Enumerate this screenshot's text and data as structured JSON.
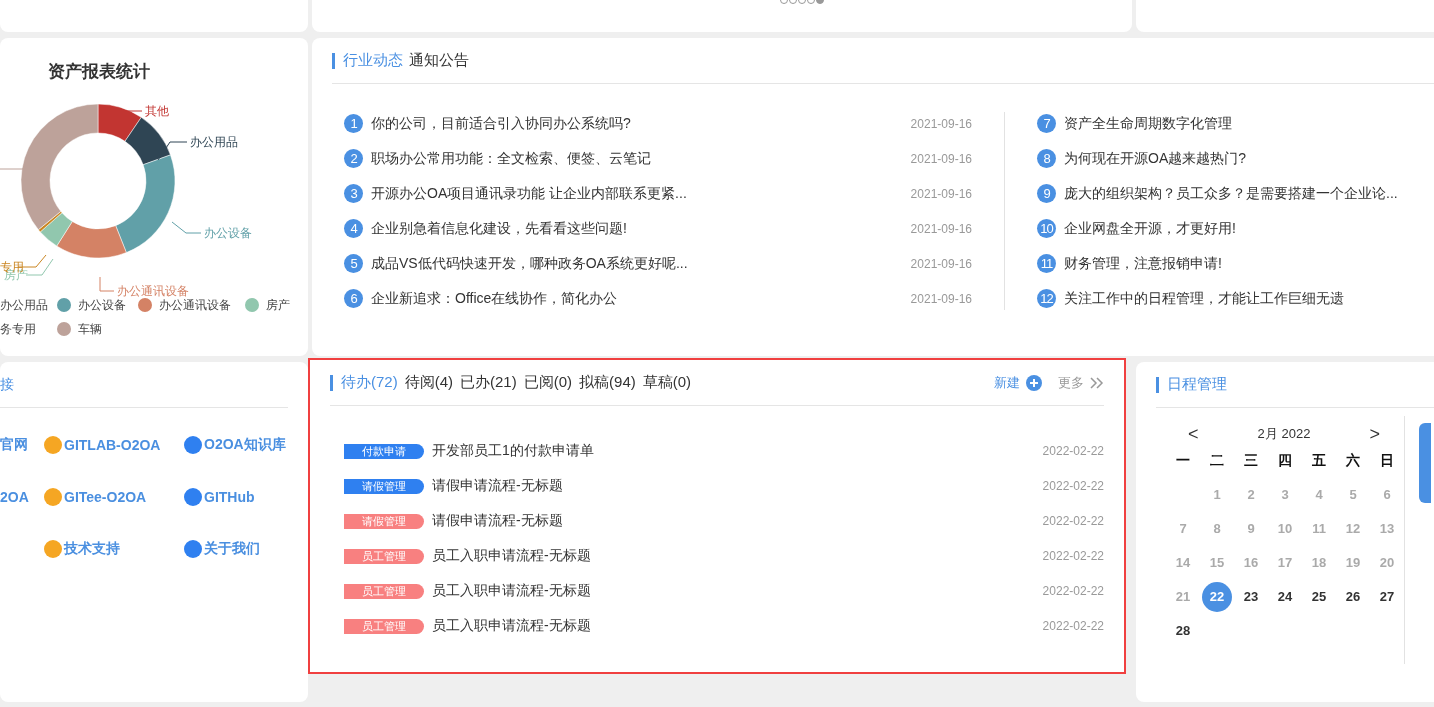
{
  "carousel_dots": [
    {
      "selected": false
    },
    {
      "selected": false
    },
    {
      "selected": false
    },
    {
      "selected": false
    },
    {
      "selected": true
    }
  ],
  "asset_chart": {
    "title": "资产报表统计",
    "slices": [
      {
        "label": "其他",
        "color": "#c23531"
      },
      {
        "label": "办公用品",
        "color": "#2f4554"
      },
      {
        "label": "办公设备",
        "color": "#61a0a8"
      },
      {
        "label": "办公通讯设备",
        "color": "#d48265"
      },
      {
        "label": "房产",
        "color": "#91c7ae"
      },
      {
        "label": "专用",
        "color": "#ca8622"
      },
      {
        "color": "#bda29a"
      }
    ],
    "legend": [
      {
        "label": "办公用品"
      },
      {
        "label": "办公设备",
        "color": "#61a0a8"
      },
      {
        "label": "办公通讯设备",
        "color": "#d48265"
      },
      {
        "label": "房产",
        "color": "#91c7ae"
      },
      {
        "label": "务专用"
      },
      {
        "label": "车辆",
        "color": "#bda29a"
      }
    ]
  },
  "news": {
    "tabs": [
      {
        "label": "行业动态",
        "selected": true
      },
      {
        "label": "通知公告",
        "selected": false
      }
    ],
    "columns": [
      [
        {
          "num": "1",
          "title": "你的公司，目前适合引入协同办公系统吗?",
          "date": "2021-09-16"
        },
        {
          "num": "2",
          "title": "职场办公常用功能：全文检索、便签、云笔记",
          "date": "2021-09-16"
        },
        {
          "num": "3",
          "title": "开源办公OA项目通讯录功能 让企业内部联系更紧...",
          "date": "2021-09-16"
        },
        {
          "num": "4",
          "title": "企业别急着信息化建设，先看看这些问题!",
          "date": "2021-09-16"
        },
        {
          "num": "5",
          "title": "成品VS低代码快速开发，哪种政务OA系统更好呢...",
          "date": "2021-09-16"
        },
        {
          "num": "6",
          "title": "企业新追求：Office在线协作，简化办公",
          "date": "2021-09-16"
        }
      ],
      [
        {
          "num": "7",
          "title": "资产全生命周期数字化管理"
        },
        {
          "num": "8",
          "title": "为何现在开源OA越来越热门?"
        },
        {
          "num": "9",
          "title": "庞大的组织架构？员工众多？是需要搭建一个企业论..."
        },
        {
          "num": "10",
          "title": "企业网盘全开源，才更好用!"
        },
        {
          "num": "11",
          "title": "财务管理，注意报销申请!"
        },
        {
          "num": "12",
          "title": "关注工作中的日程管理，才能让工作巨细无遗"
        }
      ]
    ]
  },
  "links": {
    "title": "接",
    "columns": [
      [
        {
          "label": "官网"
        },
        {
          "label": "2OA"
        }
      ],
      [
        {
          "label": "GITLAB-O2OA",
          "color": "#f5a623"
        },
        {
          "label": "GITee-O2OA",
          "color": "#f5a623"
        },
        {
          "label": "技术支持",
          "color": "#f5a623"
        }
      ],
      [
        {
          "label": "O2OA知识库",
          "color": "#2f80f0"
        },
        {
          "label": "GITHub",
          "color": "#2f80f0"
        },
        {
          "label": "关于我们",
          "color": "#2f80f0"
        }
      ]
    ]
  },
  "tasks": {
    "tabs": [
      {
        "label": "待办(72)",
        "selected": true
      },
      {
        "label": "待阅(4)",
        "selected": false
      },
      {
        "label": "已办(21)",
        "selected": false
      },
      {
        "label": "已阅(0)",
        "selected": false
      },
      {
        "label": "拟稿(94)",
        "selected": false
      },
      {
        "label": "草稿(0)",
        "selected": false
      }
    ],
    "new_label": "新建",
    "more_label": "更多",
    "items": [
      {
        "tag": "付款申请",
        "color": "#2f80f0",
        "title": "开发部员工1的付款申请单",
        "date": "2022-02-22"
      },
      {
        "tag": "请假管理",
        "color": "#2f80f0",
        "title": "请假申请流程-无标题",
        "date": "2022-02-22"
      },
      {
        "tag": "请假管理",
        "color": "#f88080",
        "title": "请假申请流程-无标题",
        "date": "2022-02-22"
      },
      {
        "tag": "员工管理",
        "color": "#f88080",
        "title": "员工入职申请流程-无标题",
        "date": "2022-02-22"
      },
      {
        "tag": "员工管理",
        "color": "#f88080",
        "title": "员工入职申请流程-无标题",
        "date": "2022-02-22"
      },
      {
        "tag": "员工管理",
        "color": "#f88080",
        "title": "员工入职申请流程-无标题",
        "date": "2022-02-22"
      }
    ]
  },
  "schedule": {
    "title": "日程管理",
    "prev": "<",
    "month": "2月 2022",
    "next": ">",
    "weekdays": [
      "一",
      "二",
      "三",
      "四",
      "五",
      "六",
      "日"
    ],
    "weeks": [
      [
        {
          "day": "1",
          "past": true,
          "selected": false
        },
        {
          "day": "2",
          "past": true,
          "selected": false
        },
        {
          "day": "3",
          "past": true,
          "selected": false
        },
        {
          "day": "4",
          "past": true,
          "selected": false
        },
        {
          "day": "5",
          "past": true,
          "selected": false
        },
        {
          "day": "6",
          "past": true,
          "selected": false
        }
      ],
      [
        {
          "day": "7",
          "past": true,
          "selected": false
        },
        {
          "day": "8",
          "past": true,
          "selected": false
        },
        {
          "day": "9",
          "past": true,
          "selected": false
        },
        {
          "day": "10",
          "past": true,
          "selected": false
        },
        {
          "day": "11",
          "past": true,
          "selected": false
        },
        {
          "day": "12",
          "past": true,
          "selected": false
        },
        {
          "day": "13",
          "past": true,
          "selected": false
        }
      ],
      [
        {
          "day": "14",
          "past": true,
          "selected": false
        },
        {
          "day": "15",
          "past": true,
          "selected": false
        },
        {
          "day": "16",
          "past": true,
          "selected": false
        },
        {
          "day": "17",
          "past": true,
          "selected": false
        },
        {
          "day": "18",
          "past": true,
          "selected": false
        },
        {
          "day": "19",
          "past": true,
          "selected": false
        },
        {
          "day": "20",
          "past": true,
          "selected": false
        }
      ],
      [
        {
          "day": "21",
          "past": true,
          "selected": false
        },
        {
          "day": "22",
          "past": false,
          "selected": true
        },
        {
          "day": "23",
          "past": false,
          "selected": false
        },
        {
          "day": "24",
          "past": false,
          "selected": false
        },
        {
          "day": "25",
          "past": false,
          "selected": false
        },
        {
          "day": "26",
          "past": false,
          "selected": false
        },
        {
          "day": "27",
          "past": false,
          "selected": false
        }
      ],
      [
        {
          "day": "28",
          "past": false,
          "selected": false
        }
      ]
    ]
  }
}
